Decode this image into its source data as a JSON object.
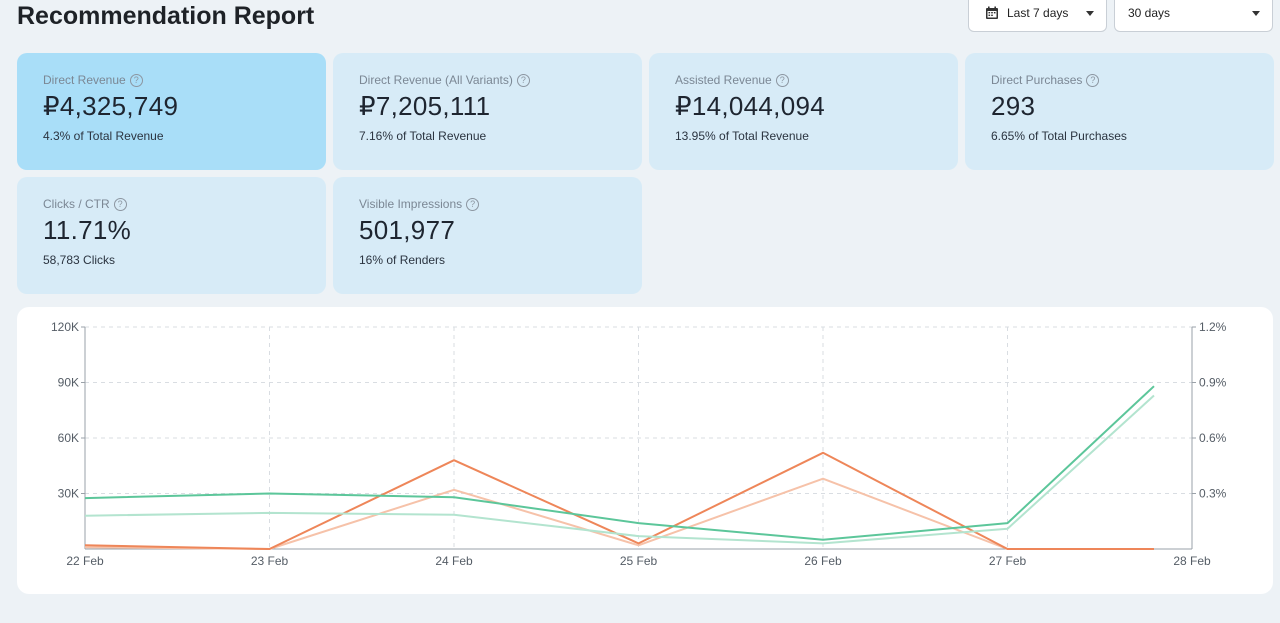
{
  "header": {
    "title": "Recommendation Report",
    "range_dropdown": "Last 7 days",
    "period_dropdown": "30 days"
  },
  "cards": [
    {
      "label": "Direct Revenue",
      "value": "₽4,325,749",
      "sub": "4.3% of Total Revenue",
      "active": true
    },
    {
      "label": "Direct Revenue (All Variants)",
      "value": "₽7,205,111",
      "sub": "7.16% of Total Revenue"
    },
    {
      "label": "Assisted Revenue",
      "value": "₽14,044,094",
      "sub": "13.95% of Total Revenue"
    },
    {
      "label": "Direct Purchases",
      "value": "293",
      "sub": "6.65% of Total Purchases"
    },
    {
      "label": "Clicks / CTR",
      "value": "11.71%",
      "sub": "58,783 Clicks"
    },
    {
      "label": "Visible Impressions",
      "value": "501,977",
      "sub": "16% of Renders"
    }
  ],
  "help_glyph": "?",
  "chart_data": {
    "type": "line",
    "x": [
      "22 Feb",
      "23 Feb",
      "24 Feb",
      "25 Feb",
      "26 Feb",
      "27 Feb",
      "28 Feb"
    ],
    "y_left_ticks": [
      "120K",
      "90K",
      "60K",
      "30K"
    ],
    "y_left_lim": [
      0,
      120000
    ],
    "y_right_ticks": [
      "1.2%",
      "0.9%",
      "0.6%",
      "0.3%"
    ],
    "y_right_lim": [
      0,
      1.2
    ],
    "grid": true,
    "series": [
      {
        "axis": "left",
        "color": "#5cc69a",
        "values": [
          27500,
          30000,
          28000,
          14000,
          5000,
          14000,
          88000
        ]
      },
      {
        "axis": "left",
        "color": "#b3e4cf",
        "values": [
          18000,
          19500,
          18500,
          7000,
          3000,
          11000,
          83000
        ]
      },
      {
        "axis": "right",
        "color": "#ee8659",
        "values": [
          0.02,
          0.0,
          0.48,
          0.03,
          0.52,
          0.0,
          0.0
        ]
      },
      {
        "axis": "right",
        "color": "#f6c2a9",
        "values": [
          0.01,
          0.0,
          0.32,
          0.02,
          0.38,
          0.0,
          0.0
        ]
      }
    ]
  }
}
